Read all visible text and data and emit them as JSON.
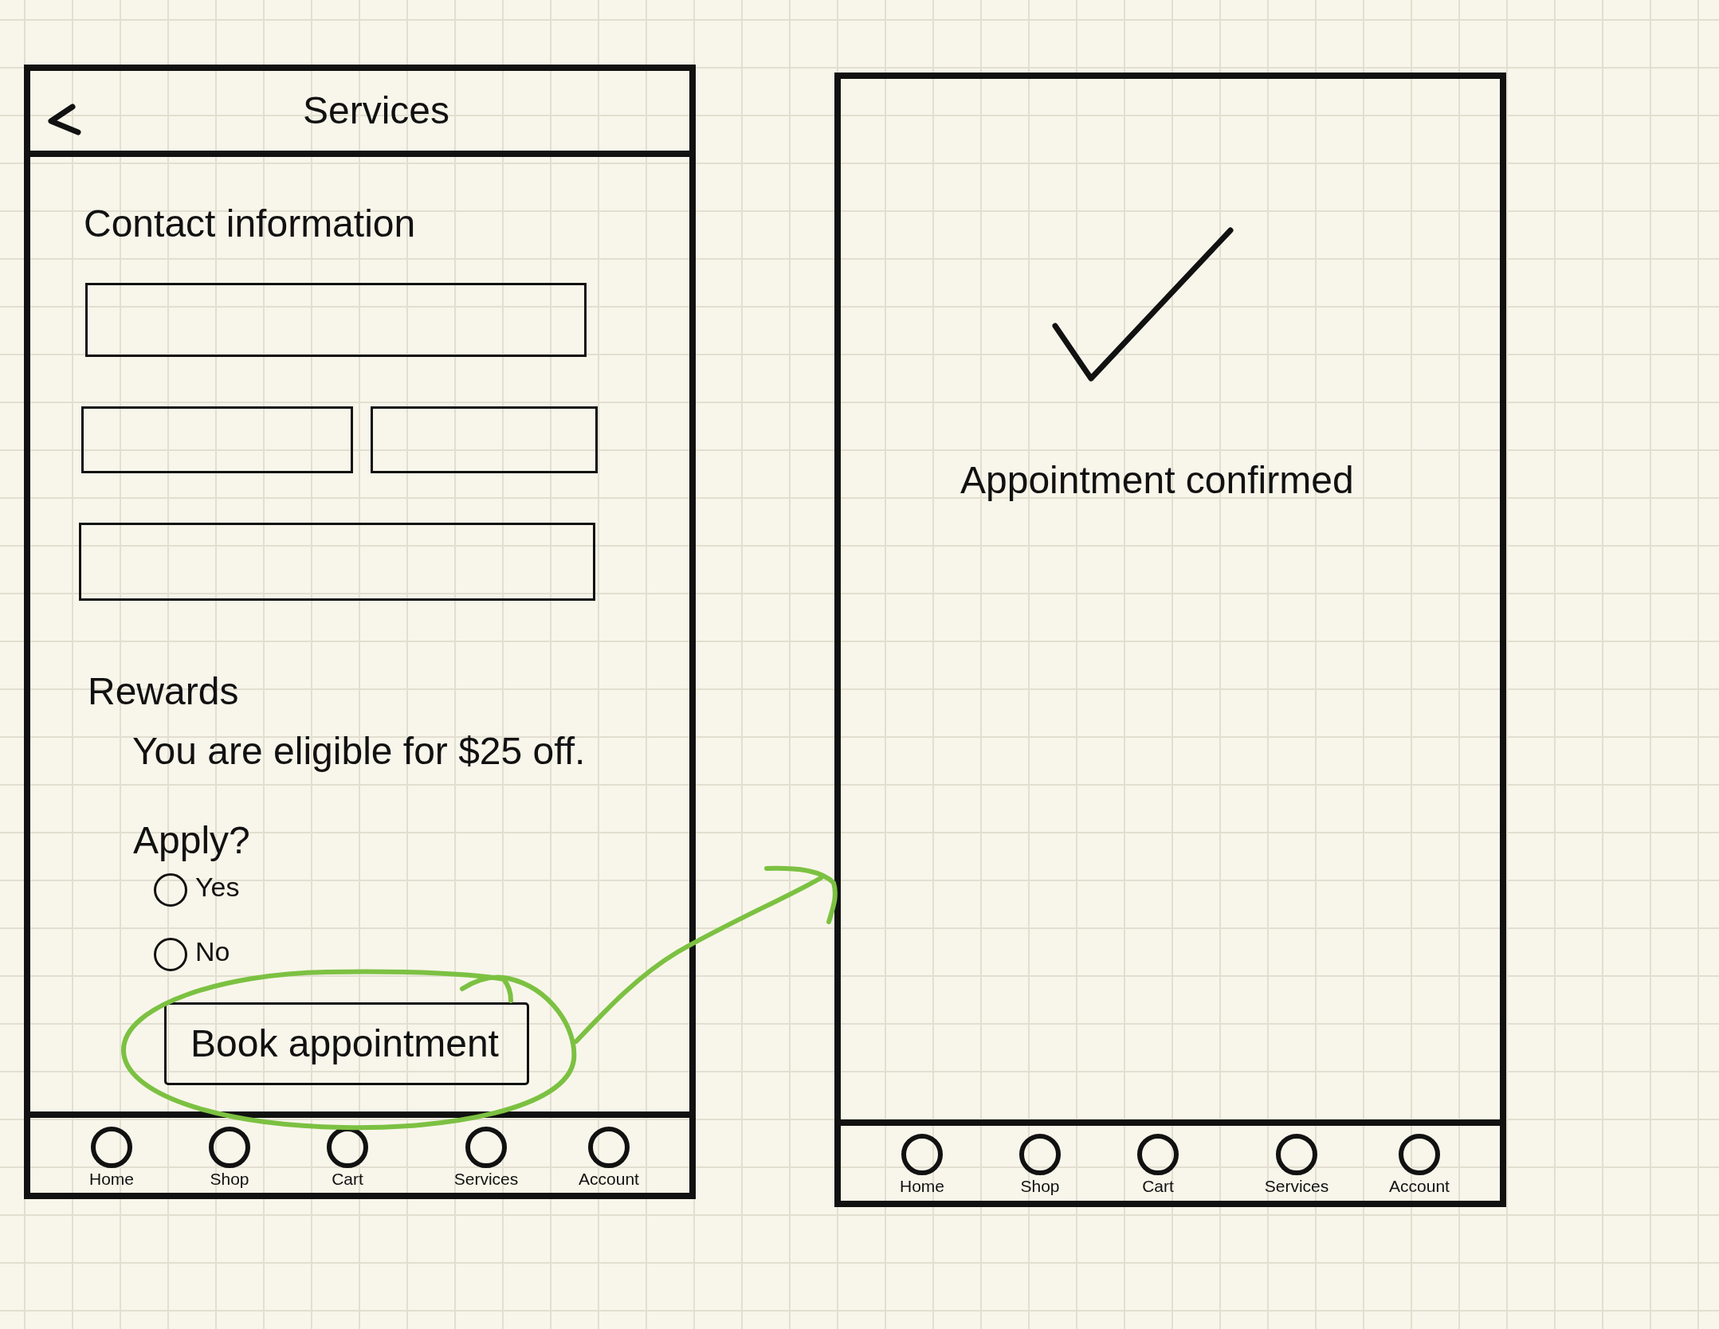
{
  "form_screen": {
    "header": {
      "title": "Services"
    },
    "contact_section": {
      "heading": "Contact information",
      "field_rows": [
        {
          "fields": [
            {
              "kind": "text_input"
            }
          ]
        },
        {
          "fields": [
            {
              "kind": "text_input"
            },
            {
              "kind": "text_input"
            }
          ]
        },
        {
          "fields": [
            {
              "kind": "text_input"
            }
          ]
        }
      ]
    },
    "rewards_section": {
      "heading": "Rewards",
      "message": "You are eligible for $25 off.",
      "question": "Apply?",
      "options": [
        {
          "label": "Yes",
          "selected": false
        },
        {
          "label": "No",
          "selected": false
        }
      ]
    },
    "submit_button": {
      "label": "Book appointment",
      "circled": true,
      "arrow_to_confirmation": true
    },
    "nav": [
      {
        "label": "Home",
        "selected": false
      },
      {
        "label": "Shop",
        "selected": false
      },
      {
        "label": "Cart",
        "selected": false
      },
      {
        "label": "Services",
        "selected": false
      },
      {
        "label": "Account",
        "selected": false
      }
    ]
  },
  "confirmation_screen": {
    "message": "Appointment confirmed",
    "nav": [
      {
        "label": "Home",
        "selected": false
      },
      {
        "label": "Shop",
        "selected": false
      },
      {
        "label": "Cart",
        "selected": false
      },
      {
        "label": "Services",
        "selected": false
      },
      {
        "label": "Account",
        "selected": false
      }
    ]
  }
}
